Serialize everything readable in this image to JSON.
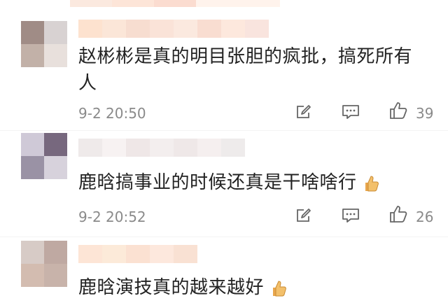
{
  "comments": [
    {
      "text": "赵彬彬是真的明目张胆的疯批，搞死所有人",
      "timestamp": "9-2 20:50",
      "likes": "39",
      "emoji": "",
      "avatar_colors": [
        "#a08c86",
        "#d8d2d2",
        "#c2b1a8",
        "#e8e0dc"
      ],
      "mosaic_colors": [
        "#fde2cf",
        "#fbe6d8",
        "#f7ddd0",
        "#fae3d8",
        "#fbe9df",
        "#f9ddd1",
        "#fde8dd",
        "#f9e4de"
      ]
    },
    {
      "text": "鹿晗搞事业的时候还真是干啥啥行",
      "timestamp": "9-2 20:52",
      "likes": "26",
      "emoji": "thumbs-up-emoji",
      "avatar_colors": [
        "#cfc9d7",
        "#77687e",
        "#9a92a5",
        "#d7d2dc"
      ],
      "mosaic_colors": [
        "#efeaea",
        "#f7f2f2",
        "#efe7e7",
        "#f3eeee",
        "#efe8e8",
        "#f5efef",
        "#eeebeb"
      ]
    },
    {
      "text": "鹿晗演技真的越来越好",
      "timestamp": "",
      "likes": "",
      "emoji": "thumbs-up-emoji",
      "avatar_colors": [
        "#d7cbc6",
        "#bfa9a2",
        "#d3bcb0",
        "#c8b3aa"
      ],
      "mosaic_colors": [
        "#fde5d6",
        "#fcead9",
        "#fbe1d2",
        "#fde8dd",
        "#f9e1d3"
      ]
    }
  ],
  "icons": {
    "share": "share-icon",
    "comment": "comment-icon",
    "like": "thumbs-up-icon"
  }
}
